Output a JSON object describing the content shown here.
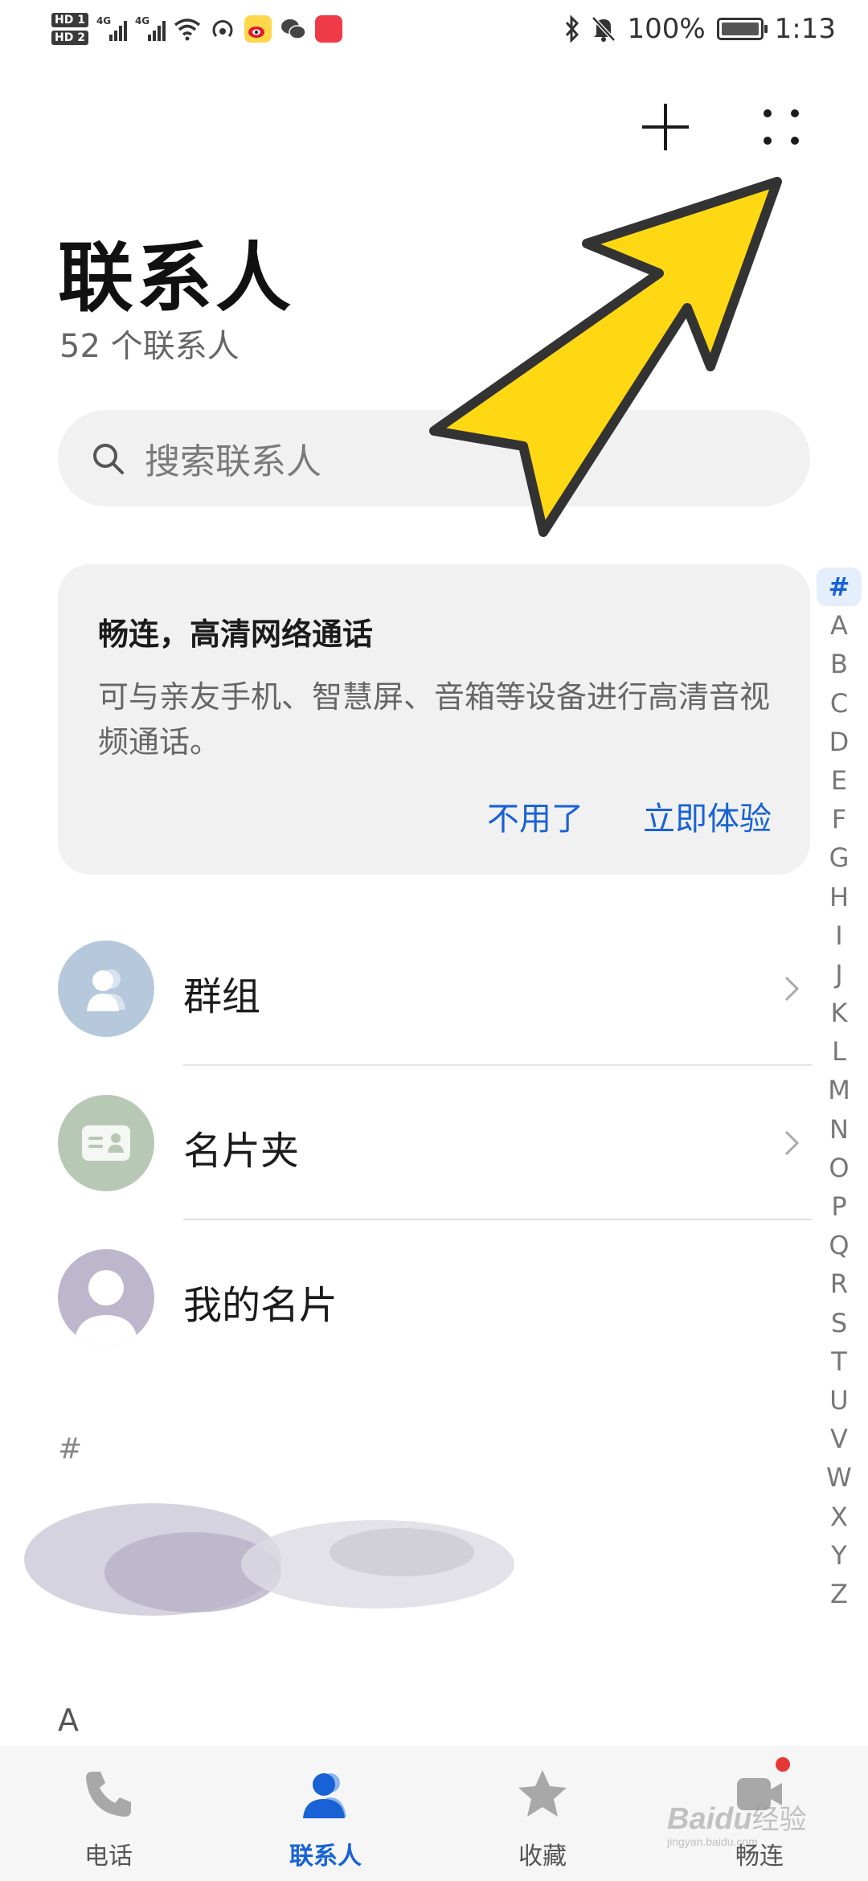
{
  "status_bar": {
    "hd1": "HD 1",
    "hd2": "HD 2",
    "net1": "4G",
    "net2": "4G",
    "battery_percent": "100%",
    "time": "1:13",
    "app_badges": [
      "weibo-icon",
      "wechat-icon",
      "huawei-appgallery-icon"
    ]
  },
  "toolbar": {
    "add_icon": "plus-icon",
    "more_icon": "more-dots-icon"
  },
  "header": {
    "title": "联系人",
    "count": "52 个联系人"
  },
  "search": {
    "placeholder": "搜索联系人"
  },
  "promo": {
    "title": "畅连，高清网络通话",
    "body": "可与亲友手机、智慧屏、音箱等设备进行高清音视频通话。",
    "dismiss": "不用了",
    "try": "立即体验"
  },
  "list": [
    {
      "label": "群组",
      "icon": "group-icon"
    },
    {
      "label": "名片夹",
      "icon": "card-holder-icon"
    },
    {
      "label": "我的名片",
      "icon": "person-icon"
    }
  ],
  "sections": {
    "hash": "#",
    "a": "A"
  },
  "index": [
    "#",
    "A",
    "B",
    "C",
    "D",
    "E",
    "F",
    "G",
    "H",
    "I",
    "J",
    "K",
    "L",
    "M",
    "N",
    "O",
    "P",
    "Q",
    "R",
    "S",
    "T",
    "U",
    "V",
    "W",
    "X",
    "Y",
    "Z"
  ],
  "bottom_nav": [
    {
      "label": "电话",
      "icon": "phone-icon",
      "active": false
    },
    {
      "label": "联系人",
      "icon": "contacts-icon",
      "active": true
    },
    {
      "label": "收藏",
      "icon": "star-icon",
      "active": false
    },
    {
      "label": "畅连",
      "icon": "meetime-icon",
      "active": false
    }
  ],
  "watermark": {
    "brand": "Baidu",
    "suffix": "经验",
    "url": "jingyan.baidu.com"
  },
  "colors": {
    "accent": "#1862d6",
    "annotation_arrow": "#ffd814"
  }
}
